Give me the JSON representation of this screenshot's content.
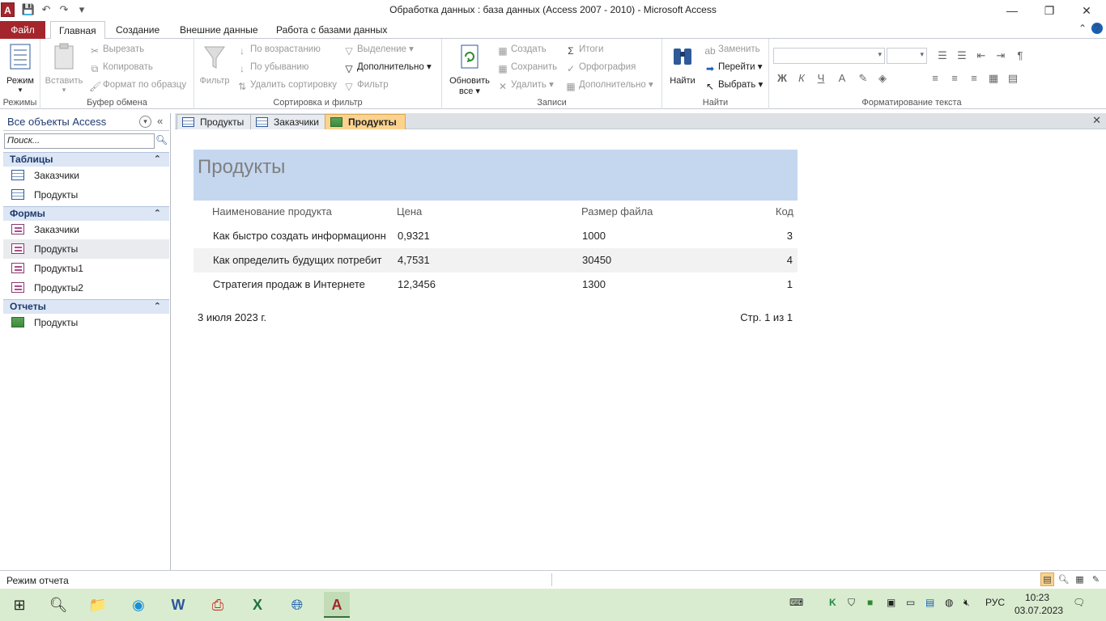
{
  "window": {
    "title": "Обработка данных : база данных (Access 2007 - 2010)  -  Microsoft Access",
    "app_letter": "A"
  },
  "menu": {
    "file": "Файл",
    "tabs": [
      "Главная",
      "Создание",
      "Внешние данные",
      "Работа с базами данных"
    ]
  },
  "ribbon": {
    "groups": {
      "views": "Режимы",
      "clipboard": "Буфер обмена",
      "sort_filter": "Сортировка и фильтр",
      "records": "Записи",
      "find": "Найти",
      "text_format": "Форматирование текста"
    },
    "view_btn": "Режим",
    "paste_btn": "Вставить",
    "cut": "Вырезать",
    "copy": "Копировать",
    "format_painter": "Формат по образцу",
    "filter_btn": "Фильтр",
    "sort_asc": "По возрастанию",
    "sort_desc": "По убыванию",
    "remove_sort": "Удалить сортировку",
    "selection": "Выделение",
    "advanced": "Дополнительно",
    "toggle_filter": "Фильтр",
    "refresh_btn_line1": "Обновить",
    "refresh_btn_line2": "все",
    "new_record": "Создать",
    "save_record": "Сохранить",
    "delete_record": "Удалить",
    "totals": "Итоги",
    "spelling": "Орфография",
    "more_records": "Дополнительно",
    "find_btn": "Найти",
    "replace": "Заменить",
    "goto": "Перейти",
    "select": "Выбрать",
    "bold": "Ж",
    "italic": "К",
    "underline": "Ч",
    "font_color": "A"
  },
  "nav": {
    "title": "Все объекты Access",
    "search_placeholder": "Поиск...",
    "categories": [
      {
        "label": "Таблицы",
        "items": [
          "Заказчики",
          "Продукты"
        ]
      },
      {
        "label": "Формы",
        "items": [
          "Заказчики",
          "Продукты",
          "Продукты1",
          "Продукты2"
        ]
      },
      {
        "label": "Отчеты",
        "items": [
          "Продукты"
        ]
      }
    ]
  },
  "doc_tabs": [
    {
      "label": "Продукты",
      "kind": "table"
    },
    {
      "label": "Заказчики",
      "kind": "table"
    },
    {
      "label": "Продукты",
      "kind": "report"
    }
  ],
  "report": {
    "title": "Продукты",
    "columns": [
      "Наименование продукта",
      "Цена",
      "Размер файла",
      "Код"
    ],
    "rows": [
      [
        "Как быстро создать информационн",
        "0,9321",
        "1000",
        "3"
      ],
      [
        "Как определить будущих потребит",
        "4,7531",
        "30450",
        "4"
      ],
      [
        "Стратегия продаж в Интернете",
        "12,3456",
        "1300",
        "1"
      ]
    ],
    "date": "3 июля 2023 г.",
    "page": "Стр. 1 из 1"
  },
  "status": {
    "text": "Режим отчета"
  },
  "taskbar": {
    "lang": "РУС",
    "time": "10:23",
    "date": "03.07.2023"
  },
  "colors": {
    "access_brand": "#a4262c",
    "report_header": "#c5d7ef",
    "active_tab": "#fbd38e",
    "taskbar": "#d9ecd0"
  }
}
